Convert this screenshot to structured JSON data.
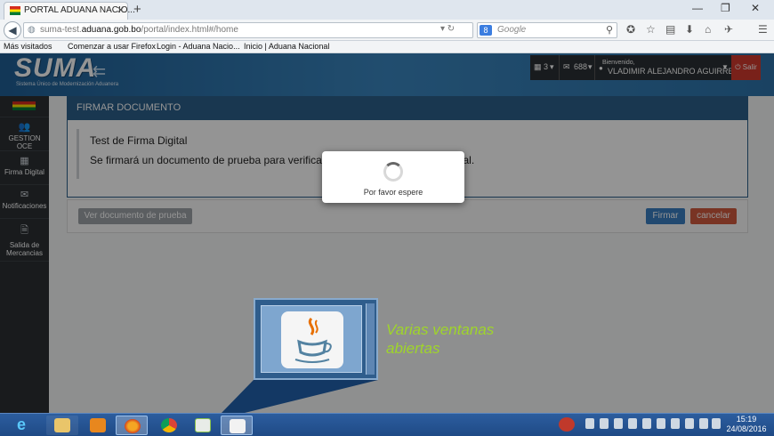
{
  "browser": {
    "tab_title": "PORTAL ADUANA NACIO...",
    "new_tab_symbol": "+",
    "url_prefix": "suma-test.",
    "url_domain": "aduana.gob.bo",
    "url_path": "/portal/index.html#/home",
    "search_engine_badge": "8",
    "search_placeholder": "Google",
    "window_controls": [
      "—",
      "❐",
      "✕"
    ],
    "toolbar_icons": [
      "star-icon",
      "bookmark-list-icon",
      "download-icon",
      "home-icon",
      "addon-icon",
      "menu-icon"
    ]
  },
  "bookmarks": [
    "Más visitados",
    "Comenzar a usar Firefox",
    "Login - Aduana Nacio...",
    "Inicio | Aduana Nacional"
  ],
  "header": {
    "logo": "SUMA",
    "logo_subtitle": "Sistema Único de Modernización Aduanera",
    "tasks_count": "3",
    "messages_count": "688",
    "welcome_label": "Bienvenido,",
    "user_name": "VLADIMIR ALEJANDRO AGUIRRE ...",
    "logout_label": "Salir"
  },
  "sidebar": {
    "items": [
      {
        "label": "GESTION OCE",
        "icon": "users-icon"
      },
      {
        "label": "Firma Digital",
        "icon": "qr-icon"
      },
      {
        "label": "Notificaciones",
        "icon": "envelope-icon"
      },
      {
        "label": "Salida de Mercancias",
        "icon": "document-icon"
      }
    ]
  },
  "panel": {
    "title": "FIRMAR DOCUMENTO",
    "line1": "Test de Firma Digital",
    "line2_start": "Se firmará un documento de prueba para verificar",
    "line2_end": "do Digital."
  },
  "actions": {
    "view_label": "Ver documento de prueba",
    "sign_label": "Firmar",
    "cancel_label": "cancelar"
  },
  "modal": {
    "message": "Por favor espere"
  },
  "callout": {
    "line1": "Varias ventanas",
    "line2": "abiertas",
    "color": "#9fd52a"
  },
  "taskbar": {
    "apps": [
      "internet-explorer-icon",
      "file-explorer-icon",
      "outlook-icon",
      "firefox-icon",
      "chrome-icon",
      "hdd-app-icon",
      "java-icon"
    ],
    "time": "15:19",
    "date": "24/08/2016"
  }
}
